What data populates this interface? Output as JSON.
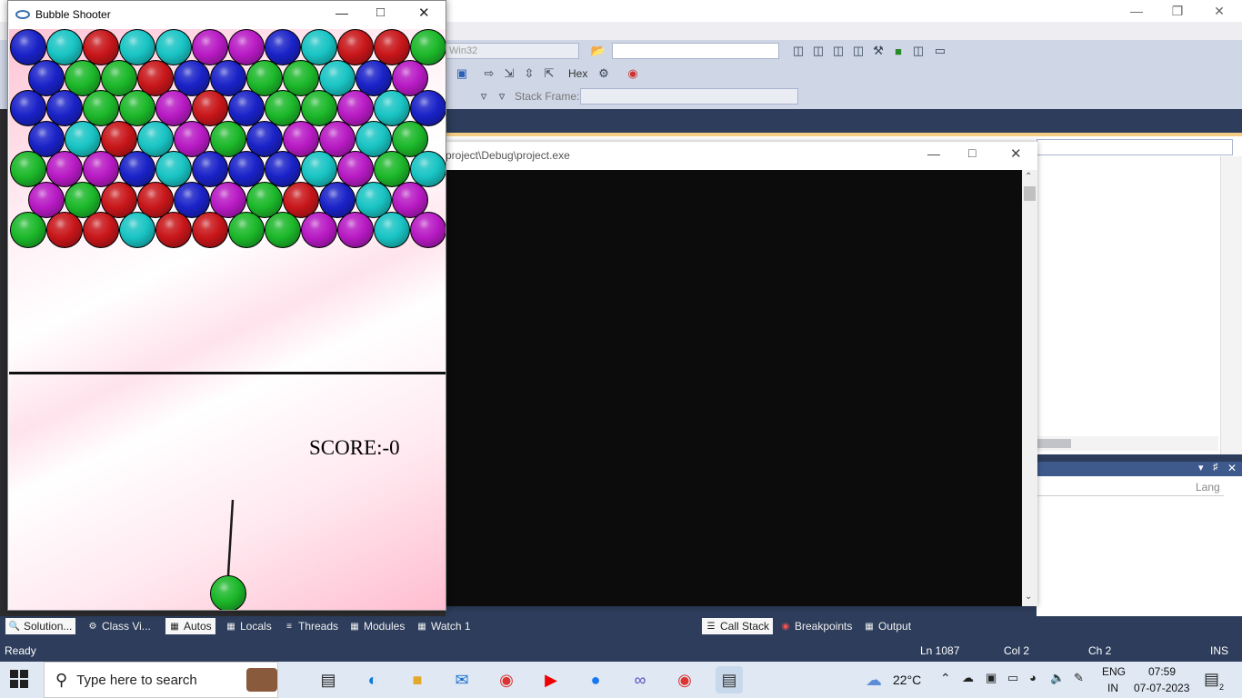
{
  "game_window": {
    "title": "Bubble Shooter",
    "score_text": "SCORE:-0",
    "colors": {
      "blue": "#1a22c8",
      "cyan": "#19c4c4",
      "red": "#c8161a",
      "magenta": "#b81ac4",
      "green": "#1cb82a"
    },
    "bubble_rows": [
      [
        "blue",
        "cyan",
        "red",
        "cyan",
        "cyan",
        "magenta",
        "magenta",
        "blue",
        "cyan",
        "red",
        "red",
        "green"
      ],
      [
        "blue",
        "green",
        "green",
        "red",
        "blue",
        "blue",
        "green",
        "green",
        "cyan",
        "blue",
        "magenta"
      ],
      [
        "blue",
        "blue",
        "green",
        "green",
        "magenta",
        "red",
        "blue",
        "green",
        "green",
        "magenta",
        "cyan",
        "blue"
      ],
      [
        "blue",
        "cyan",
        "red",
        "cyan",
        "magenta",
        "green",
        "blue",
        "magenta",
        "magenta",
        "cyan",
        "green"
      ],
      [
        "green",
        "magenta",
        "magenta",
        "blue",
        "cyan",
        "blue",
        "blue",
        "blue",
        "cyan",
        "magenta",
        "green",
        "cyan"
      ],
      [
        "magenta",
        "green",
        "red",
        "red",
        "blue",
        "magenta",
        "green",
        "red",
        "blue",
        "cyan",
        "magenta"
      ],
      [
        "green",
        "red",
        "red",
        "cyan",
        "red",
        "red",
        "green",
        "green",
        "magenta",
        "magenta",
        "cyan",
        "magenta"
      ]
    ],
    "shooter_color": "green"
  },
  "console_window": {
    "title": "project\\Debug\\project.exe"
  },
  "vs": {
    "platform_combo": "Win32",
    "hex_label": "Hex",
    "stack_frame_label": "Stack Frame:",
    "lang_column": "Lang"
  },
  "tabs": [
    {
      "label": "Solution...",
      "icon": "solution-explorer-icon",
      "active": true
    },
    {
      "label": "Class Vi...",
      "icon": "class-view-icon",
      "active": false
    },
    {
      "label": "Autos",
      "icon": "autos-icon",
      "active": true
    },
    {
      "label": "Locals",
      "icon": "locals-icon",
      "active": false
    },
    {
      "label": "Threads",
      "icon": "threads-icon",
      "active": false
    },
    {
      "label": "Modules",
      "icon": "modules-icon",
      "active": false
    },
    {
      "label": "Watch 1",
      "icon": "watch-icon",
      "active": false
    },
    {
      "label": "Call Stack",
      "icon": "call-stack-icon",
      "active": true
    },
    {
      "label": "Breakpoints",
      "icon": "breakpoints-icon",
      "active": false
    },
    {
      "label": "Output",
      "icon": "output-icon",
      "active": false
    }
  ],
  "statusbar": {
    "status": "Ready",
    "line": "Ln 1087",
    "col": "Col 2",
    "ch": "Ch 2",
    "mode": "INS"
  },
  "taskbar": {
    "search_placeholder": "Type here to search",
    "temperature": "22°C",
    "language": "ENG",
    "region": "IN",
    "time": "07:59",
    "date": "07-07-2023",
    "notification_count": "2"
  }
}
